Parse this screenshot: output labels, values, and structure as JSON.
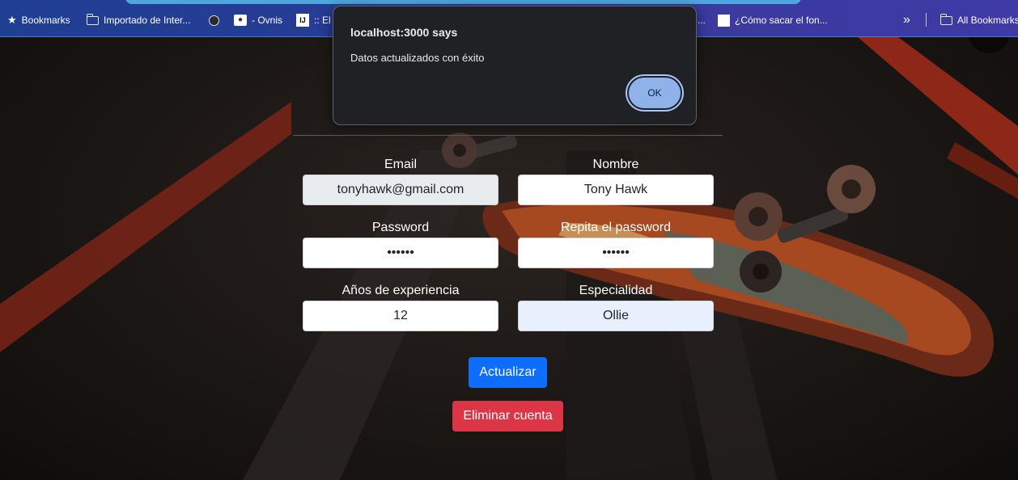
{
  "bookmarks_bar": {
    "items": [
      {
        "label": "Bookmarks",
        "icon": "star-icon"
      },
      {
        "label": "Importado de Inter...",
        "icon": "folder-icon"
      },
      {
        "label": "",
        "icon": "globe-icon"
      },
      {
        "label": "- Ovnis",
        "icon": "alien-icon"
      },
      {
        "label": ":: El e",
        "icon": "ij-icon"
      },
      {
        "label": "¿Cómo sacar el fon...",
        "icon": "page-icon"
      },
      {
        "label": "All Bookmarks",
        "icon": "folder-icon"
      }
    ],
    "overflow_icon": "chevron-double-right-icon",
    "overflow_label": "»",
    "obscured_label": "..."
  },
  "dialog": {
    "title": "localhost:3000 says",
    "message": "Datos actualizados con éxito",
    "ok_label": "OK"
  },
  "form": {
    "email": {
      "label": "Email",
      "value": "tonyhawk@gmail.com"
    },
    "nombre": {
      "label": "Nombre",
      "value": "Tony Hawk"
    },
    "password": {
      "label": "Password",
      "value": "••••••"
    },
    "repeat_password": {
      "label": "Repita el password",
      "value": "••••••"
    },
    "experiencia": {
      "label": "Años de experiencia",
      "value": "12"
    },
    "especialidad": {
      "label": "Especialidad",
      "value": "Ollie"
    },
    "update_button": "Actualizar",
    "delete_button": "Eliminar cuenta"
  },
  "colors": {
    "primary": "#0d6efd",
    "danger": "#dc3545",
    "dialog_bg": "#202124",
    "dialog_button": "#8fb2ea"
  }
}
